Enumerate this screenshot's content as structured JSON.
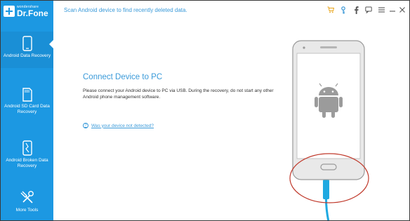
{
  "app": {
    "brand_small": "wondershare",
    "brand_name": "Dr.Fone"
  },
  "header": {
    "subtitle": "Scan Android device to find recently deleted data.",
    "icons": [
      "cart-icon",
      "key-icon",
      "facebook-icon",
      "chat-icon",
      "menu-icon"
    ]
  },
  "sidebar": {
    "items": [
      {
        "label": "Android Data Recovery",
        "icon": "phone-icon",
        "active": true
      },
      {
        "label": "Android SD Card Data Recovery",
        "icon": "sd-card-icon",
        "active": false
      },
      {
        "label": "Android Broken Data Recovery",
        "icon": "broken-phone-icon",
        "active": false
      },
      {
        "label": "More Tools",
        "icon": "tools-icon",
        "active": false
      }
    ]
  },
  "main": {
    "title": "Connect Device to PC",
    "description": "Please connect your Android device to PC via USB. During the recovery, do not start any other Android phone management software.",
    "help_link": "Was your device not detected?",
    "help_icon": "?"
  },
  "colors": {
    "sidebar_bg": "#1c98e2",
    "accent": "#3a9ad9",
    "annotation": "#c0392b",
    "cable": "#1fa9e1",
    "cart": "#e8a317"
  }
}
